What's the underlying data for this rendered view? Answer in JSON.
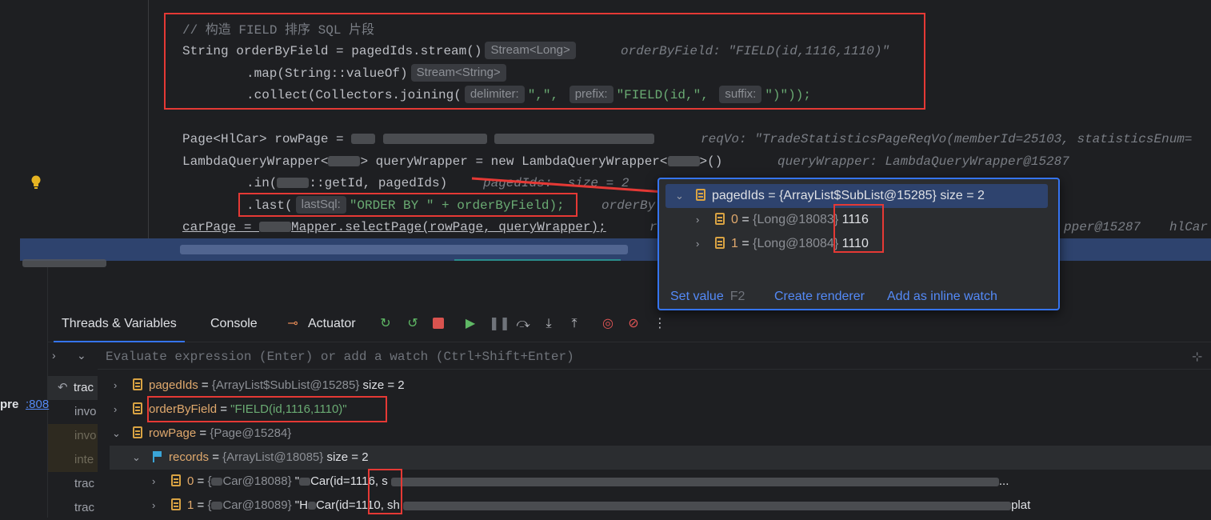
{
  "editor": {
    "comment": "// 构造 FIELD 排序 SQL 片段",
    "line1_code": "String orderByField = pagedIds.stream()",
    "line1_hint": "Stream<Long>",
    "line1_value": "orderByField: \"FIELD(id,1116,1110)\"",
    "line2_code": ".map(String::valueOf)",
    "line2_hint": "Stream<String>",
    "line3_code_a": ".collect(Collectors.joining(",
    "line3_param1": "delimiter:",
    "line3_arg1": "\",\",",
    "line3_param2": "prefix:",
    "line3_arg2": "\"FIELD(id,\",",
    "line3_param3": "suffix:",
    "line3_arg3": "\")\"));",
    "line4_code": "Page<HlCar> rowPage =",
    "line4_value": "reqVo: \"TradeStatisticsPageReqVo(memberId=25103, statisticsEnum=",
    "line5_code_a": "LambdaQueryWrapper<",
    "line5_code_b": "> queryWrapper = new LambdaQueryWrapper<",
    "line5_code_c": ">()",
    "line5_value": "queryWrapper: LambdaQueryWrapper@15287",
    "line6_code_a": ".in(",
    "line6_code_b": "::getId, pagedIds)",
    "line6_value": "pagedIds:  size = 2",
    "line7_code_a": ".last(",
    "line7_param": "lastSql:",
    "line7_code_b": "\"ORDER BY \" + orderByField);",
    "line7_value": "orderBy",
    "line8_code_a": "carPage",
    "line8_code_b": " = ",
    "line8_code_c": "Mapper.selectPage(rowPage, queryWrapper);",
    "line8_value_a": "r",
    "line8_value_b": "pper@15287",
    "line8_value_c": "hlCar"
  },
  "popup": {
    "root_name": "pagedIds",
    "root_value": "= {ArrayList$SubList@15285}  size = 2",
    "items": [
      {
        "index": "0",
        "ref": "{Long@18083}",
        "value": "1116"
      },
      {
        "index": "1",
        "ref": "{Long@18084}",
        "value": "1110"
      }
    ],
    "set_value": "Set value",
    "set_value_key": "F2",
    "create_renderer": "Create renderer",
    "add_inline_watch": "Add as inline watch"
  },
  "toolwindow": {
    "tabs": [
      "Threads & Variables",
      "Console",
      "Actuator"
    ],
    "eval_placeholder": "Evaluate expression (Enter) or add a watch (Ctrl+Shift+Enter)",
    "frames": [
      "trac",
      "invo",
      "invo",
      "inte",
      "trac",
      "trac"
    ],
    "left_label": "pre",
    "left_link": ":808"
  },
  "variables": [
    {
      "name": "pagedIds",
      "eq": " = ",
      "ref": "{ArrayList$SubList@15285}",
      "extra": "size = 2"
    },
    {
      "name": "orderByField",
      "eq": " = ",
      "value": "\"FIELD(id,1116,1110)\""
    },
    {
      "name": "rowPage",
      "eq": " = ",
      "ref": "{Page@15284}"
    },
    {
      "name": "records",
      "eq": " = ",
      "ref": "{ArrayList@18085}",
      "extra": "size = 2"
    },
    {
      "name": "0",
      "eq": " = ",
      "ref_a": "{",
      "ref_b": "Car@18088}",
      "val_a": "\"",
      "val_b": "Car(id=",
      "id": "1116",
      "val_c": ", s",
      "tail": "..."
    },
    {
      "name": "1",
      "eq": " = ",
      "ref_a": "{",
      "ref_b": "Car@18089}",
      "val_a": "\"H",
      "val_b": "Car(id=",
      "id": "1110",
      "val_c": ", sh",
      "tail": "plat"
    }
  ],
  "colors": {
    "accent": "#3574f0",
    "highlight_box": "#e53935",
    "string": "#6aab73",
    "keyword": "#cf8e6d"
  }
}
